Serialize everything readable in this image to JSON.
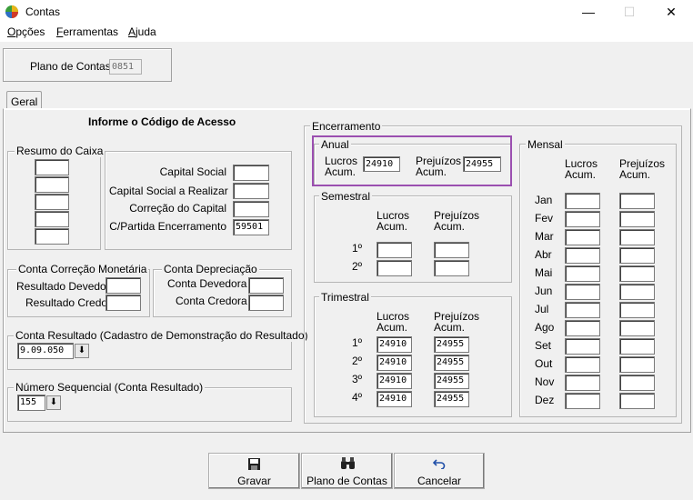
{
  "window": {
    "title": "Contas",
    "min": "—",
    "max": "☐",
    "close": "✕"
  },
  "menu": [
    "Opções",
    "Ferramentas",
    "Ajuda"
  ],
  "plano": {
    "label": "Plano de Contas",
    "value": "0851"
  },
  "tab": "Geral",
  "heading": "Informe o Código de Acesso",
  "resumo": {
    "title": "Resumo do Caixa"
  },
  "capital": {
    "labels": [
      "Capital Social",
      "Capital Social a Realizar",
      "Correção do Capital",
      "C/Partida Encerramento"
    ],
    "values": [
      "",
      "",
      "",
      "59501"
    ]
  },
  "correcao": {
    "title": "Conta Correção Monetária",
    "devedor": "Resultado Devedor",
    "credor": "Resultado Credor"
  },
  "depreciacao": {
    "title": "Conta Depreciação",
    "devedora": "Conta Devedora",
    "credora": "Conta Credora"
  },
  "resultado": {
    "title": "Conta Resultado (Cadastro de Demonstração do Resultado)",
    "value": "9.09.050"
  },
  "sequencial": {
    "title": "Número Sequencial (Conta Resultado)",
    "value": "155"
  },
  "encerramento": {
    "title": "Encerramento",
    "lucros": "Lucros",
    "prejuizos": "Prejuízos",
    "acum": "Acum.",
    "anual": {
      "title": "Anual",
      "lucros": "24910",
      "prejuizos": "24955"
    },
    "semestral": {
      "title": "Semestral",
      "rows": [
        {
          "label": "1º",
          "l": "",
          "p": ""
        },
        {
          "label": "2º",
          "l": "",
          "p": ""
        }
      ]
    },
    "trimestral": {
      "title": "Trimestral",
      "rows": [
        {
          "label": "1º",
          "l": "24910",
          "p": "24955"
        },
        {
          "label": "2º",
          "l": "24910",
          "p": "24955"
        },
        {
          "label": "3º",
          "l": "24910",
          "p": "24955"
        },
        {
          "label": "4º",
          "l": "24910",
          "p": "24955"
        }
      ]
    },
    "mensal": {
      "title": "Mensal",
      "months": [
        "Jan",
        "Fev",
        "Mar",
        "Abr",
        "Mai",
        "Jun",
        "Jul",
        "Ago",
        "Set",
        "Out",
        "Nov",
        "Dez"
      ]
    }
  },
  "buttons": {
    "gravar": "Gravar",
    "plano": "Plano de Contas",
    "cancelar": "Cancelar"
  },
  "colors": {
    "highlight": "#9b4fb0"
  }
}
